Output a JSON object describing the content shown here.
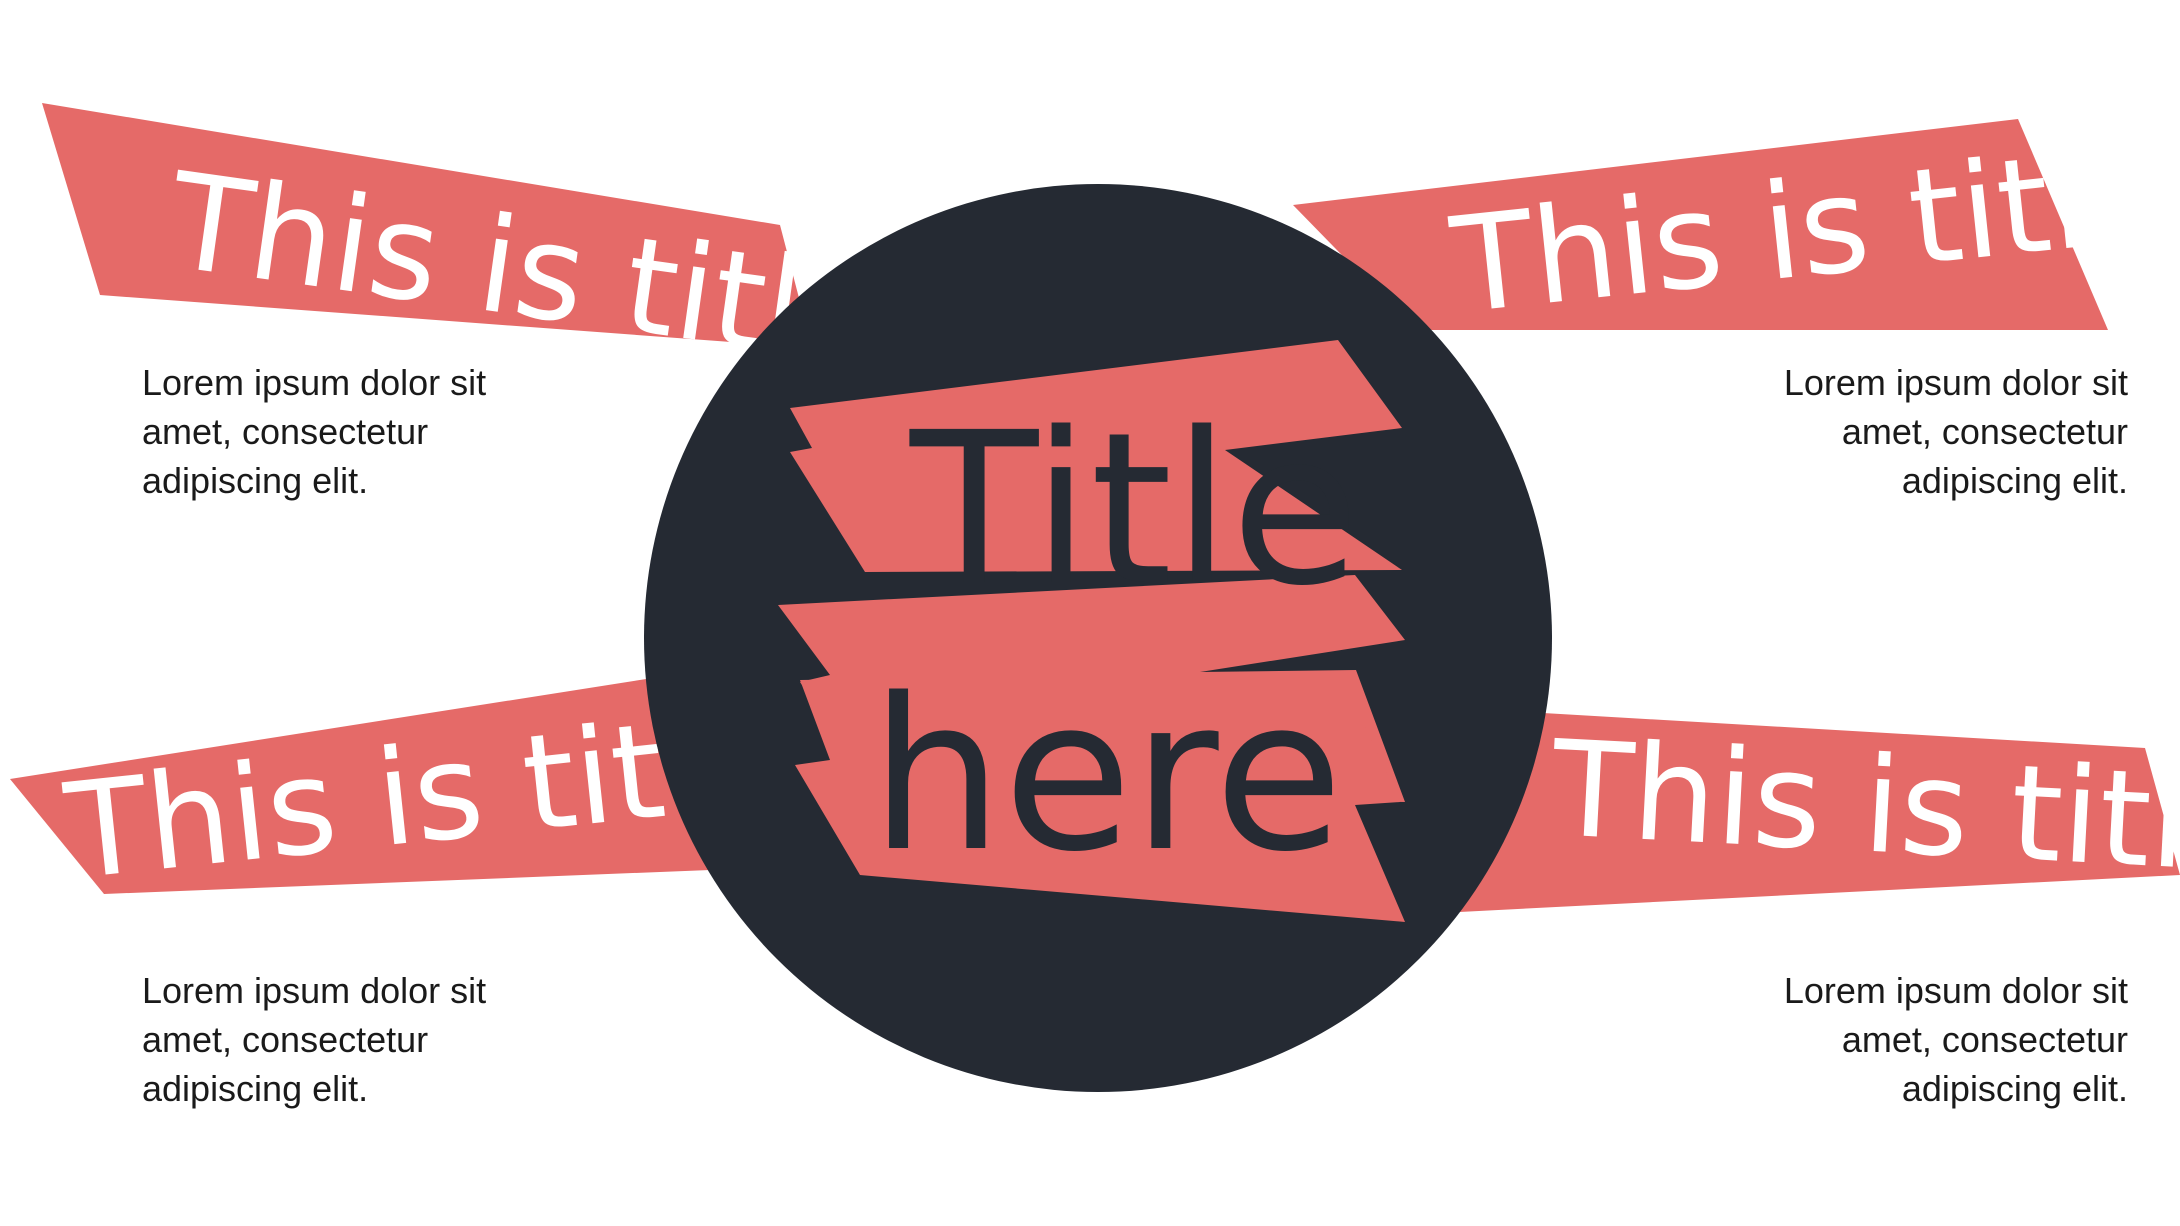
{
  "colors": {
    "accent": "#e56a68",
    "dark": "#252a33",
    "background": "#ffffff",
    "text": "#1a1a1a"
  },
  "center": {
    "line1": "Title",
    "line2": "here"
  },
  "sections": [
    {
      "title": "This is title",
      "body_line1": "Lorem ipsum dolor sit",
      "body_line2": "amet, consectetur",
      "body_line3": "adipiscing elit."
    },
    {
      "title": "This is title",
      "body_line1": "Lorem ipsum dolor sit",
      "body_line2": "amet, consectetur",
      "body_line3": "adipiscing elit."
    },
    {
      "title": "This is title",
      "body_line1": "Lorem ipsum dolor sit",
      "body_line2": "amet, consectetur",
      "body_line3": "adipiscing elit."
    },
    {
      "title": "This is title",
      "body_line1": "Lorem ipsum dolor sit",
      "body_line2": "amet, consectetur",
      "body_line3": "adipiscing elit."
    }
  ]
}
